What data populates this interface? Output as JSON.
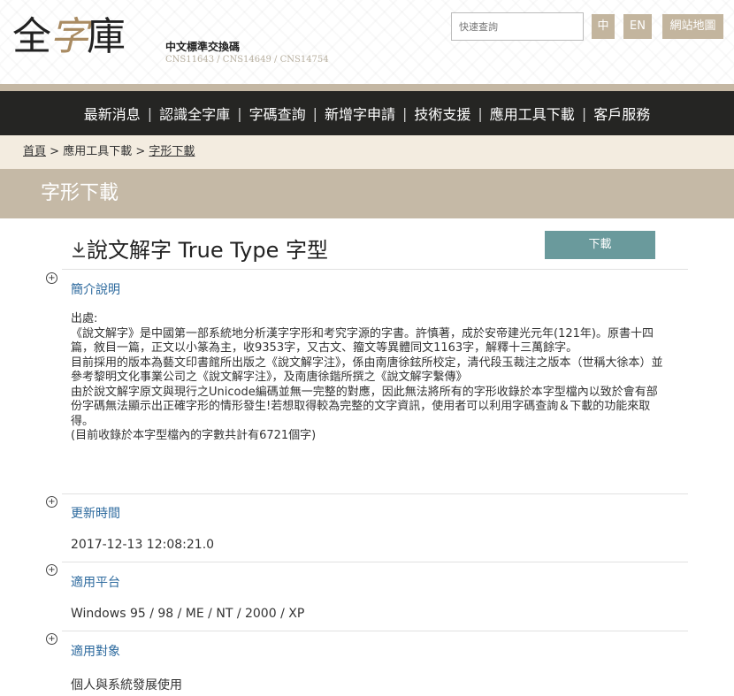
{
  "header": {
    "logo": {
      "first": "全",
      "mid": "字",
      "last": "庫"
    },
    "subtitle": "中文標準交換碼",
    "standards": "CNS11643 / CNS14649 / CNS14754",
    "search_placeholder": "快速查詢",
    "btn_zh": "中",
    "btn_en": "EN",
    "btn_sitemap": "網站地圖"
  },
  "nav": {
    "items": [
      "最新消息",
      "認識全字庫",
      "字碼查詢",
      "新增字申請",
      "技術支援",
      "應用工具下載",
      "客戶服務"
    ],
    "separator": "|"
  },
  "breadcrumb": {
    "home": "首頁",
    "sep": ">",
    "middle": "應用工具下載",
    "current": "字形下載"
  },
  "page_title": "字形下載",
  "file": {
    "icon": "download-icon",
    "title": "說文解字 True Type 字型",
    "download_label": "下載"
  },
  "sections": {
    "intro": {
      "heading": "簡介說明",
      "lines": [
        "出處:",
        "《說文解字》是中國第一部系統地分析漢字字形和考究字源的字書。許慎著，成於安帝建光元年(121年)。原書十四篇，敘目一篇，正文以小篆為主，收9353字，又古文、籀文等異體同文1163字，解釋十三萬餘字。",
        "目前採用的版本為藝文印書館所出版之《說文解字注》，係由南唐徐鉉所校定，清代段玉裁注之版本（世稱大徐本）並參考黎明文化事業公司之《說文解字注》，及南唐徐鍇所撰之《說文解字繫傳》",
        "由於說文解字原文與現行之Unicode編碼並無一完整的對應，因此無法將所有的字形收錄於本字型檔內以致於會有部份字碼無法顯示出正確字形的情形發生!若想取得較為完整的文字資訊，使用者可以利用字碼查詢＆下載的功能來取得。",
        "(目前收錄於本字型檔內的字數共計有6721個字)"
      ]
    },
    "updated": {
      "heading": "更新時間",
      "value": "2017-12-13 12:08:21.0"
    },
    "platform": {
      "heading": "適用平台",
      "value": "Windows 95 / 98 / ME / NT / 2000 / XP"
    },
    "audience": {
      "heading": "適用對象",
      "value": "個人與系統發展使用"
    },
    "expand_glyph": "+"
  }
}
